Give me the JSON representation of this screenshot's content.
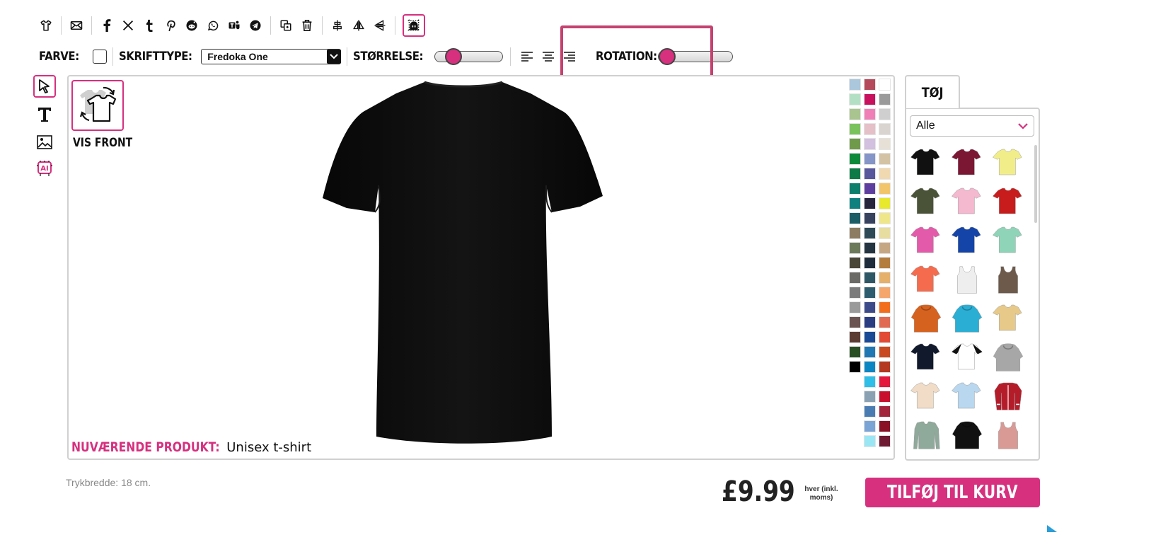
{
  "toolbar": {
    "labels": {
      "color": "FARVE:",
      "font": "SKRIFTTYPE:",
      "size": "STØRRELSE:",
      "rotation": "ROTATION:"
    },
    "font_value": "Fredoka One",
    "size_level": 0.2,
    "rotation_level": 0.0,
    "icons_row1": [
      "tshirt-icon",
      "mail-icon",
      "facebook-icon",
      "x-icon",
      "tumblr-icon",
      "pinterest-icon",
      "reddit-icon",
      "whatsapp-icon",
      "teams-icon",
      "telegram-icon",
      "duplicate-icon",
      "trash-icon",
      "align-center-icon",
      "flip-horizontal-icon",
      "flip-vertical-icon",
      "grid-snap-icon"
    ],
    "align_icons": [
      "align-left-icon",
      "align-center-icon",
      "align-right-icon"
    ]
  },
  "left_tools": [
    "select-pointer-icon",
    "text-tool-icon",
    "image-tool-icon",
    "ai-tool-icon"
  ],
  "canvas": {
    "flip_label": "VIS FRONT",
    "current_product_key": "NUVÆRENDE PRODUKT:",
    "current_product_value": "Unisex t-shirt"
  },
  "swatches": [
    [
      "#aac7db",
      "#b5485a",
      "#ffffff"
    ],
    [
      "#b3e0c4",
      "#c8105e",
      "#9a9a9a"
    ],
    [
      "#a9c48f",
      "#ef7fb6",
      "#cfcfcf"
    ],
    [
      "#7ac25c",
      "#e6c0c8",
      "#d9d4cf"
    ],
    [
      "#6f9a4a",
      "#d3bfe0",
      "#e6e0d6"
    ],
    [
      "#0c8a3a",
      "#8695c8",
      "#d3c2a4"
    ],
    [
      "#0e7a45",
      "#58569c",
      "#f0d9b0"
    ],
    [
      "#0d7d6c",
      "#5e3fa0",
      "#f2c56b"
    ],
    [
      "#10807f",
      "#27243e",
      "#e8e82c"
    ],
    [
      "#1a5d66",
      "#37425e",
      "#efe68a"
    ],
    [
      "#8d7c62",
      "#2f4a57",
      "#e8dda0"
    ],
    [
      "#6c7a5a",
      "#243440",
      "#c6a783"
    ],
    [
      "#4a4638",
      "#1f2c3c",
      "#b37d3f"
    ],
    [
      "#6b6a66",
      "#2e5766",
      "#e5b06a"
    ],
    [
      "#7c7c7c",
      "#2c5c6e",
      "#f4a66c"
    ],
    [
      "#9a9a9a",
      "#3d4a8a",
      "#f36e1c"
    ],
    [
      "#6a5350",
      "#2a3c82",
      "#e16a52"
    ],
    [
      "#5b3c33",
      "#1a4a95",
      "#e24a36"
    ],
    [
      "#284f24",
      "#1f78b4",
      "#c9481f"
    ],
    [
      "#000000",
      "#0c86c2",
      "#b3381f"
    ],
    [
      "",
      "#2ebee8",
      "#e4173d"
    ],
    [
      "",
      "#8aa1b3",
      "#c8102e"
    ],
    [
      "",
      "#4a7cb4",
      "#a1243c"
    ],
    [
      "",
      "#7aa4d6",
      "#8a1026"
    ],
    [
      "",
      "#9ae6f5",
      "#6e1a32"
    ]
  ],
  "panel": {
    "tab_label": "TØJ",
    "filter_value": "Alle",
    "products": [
      {
        "name": "black-tshirt",
        "color": "#111111",
        "kind": "tee"
      },
      {
        "name": "burgundy-tshirt",
        "color": "#7b1733",
        "kind": "tee"
      },
      {
        "name": "yellow-tshirt",
        "color": "#f1ee8a",
        "kind": "tee"
      },
      {
        "name": "olive-tshirt",
        "color": "#4a5238",
        "kind": "tee"
      },
      {
        "name": "pink-tshirt",
        "color": "#f4b8cf",
        "kind": "tee"
      },
      {
        "name": "red-tshirt",
        "color": "#c81c1c",
        "kind": "tee"
      },
      {
        "name": "magenta-tshirt",
        "color": "#e45aaa",
        "kind": "tee"
      },
      {
        "name": "royal-tshirt",
        "color": "#1544a8",
        "kind": "tee"
      },
      {
        "name": "mint-tshirt",
        "color": "#8fd4b8",
        "kind": "tee"
      },
      {
        "name": "coral-tshirt",
        "color": "#f56b4e",
        "kind": "tee"
      },
      {
        "name": "white-tank",
        "color": "#eeeeee",
        "kind": "tank"
      },
      {
        "name": "brown-tank",
        "color": "#6d5a4b",
        "kind": "tank"
      },
      {
        "name": "orange-hoodie",
        "color": "#d6621f",
        "kind": "hoodie"
      },
      {
        "name": "turquoise-hoodie",
        "color": "#2aaed4",
        "kind": "hoodie"
      },
      {
        "name": "tiedye-tshirt",
        "color": "#e7c98a",
        "kind": "tee"
      },
      {
        "name": "navy-tshirt",
        "color": "#111a2c",
        "kind": "tee"
      },
      {
        "name": "raglan-tshirt",
        "color": "#ffffff",
        "kind": "raglan"
      },
      {
        "name": "grey-hoodie",
        "color": "#a7a7a7",
        "kind": "hoodie"
      },
      {
        "name": "cream-tshirt",
        "color": "#f0dcc7",
        "kind": "tee"
      },
      {
        "name": "skyfade-tshirt",
        "color": "#b9d7ee",
        "kind": "tee"
      },
      {
        "name": "red-varsity-jacket",
        "color": "#b51c2a",
        "kind": "jacket"
      },
      {
        "name": "sage-longsleeve",
        "color": "#8fa99b",
        "kind": "longsleeve"
      },
      {
        "name": "black-orange-hoodie",
        "color": "#111111",
        "kind": "hoodie"
      },
      {
        "name": "rose-tank",
        "color": "#d99a95",
        "kind": "tank"
      }
    ]
  },
  "footer": {
    "print_width": "Trykbredde: 18 cm.",
    "price": "£9.99",
    "price_note": "hver (inkl. moms)",
    "add_to_cart": "TILFØJ TIL KURV"
  },
  "colors": {
    "accent": "#d6307f",
    "highlight": "#c4426f",
    "shirt": "#0d0d0d"
  }
}
